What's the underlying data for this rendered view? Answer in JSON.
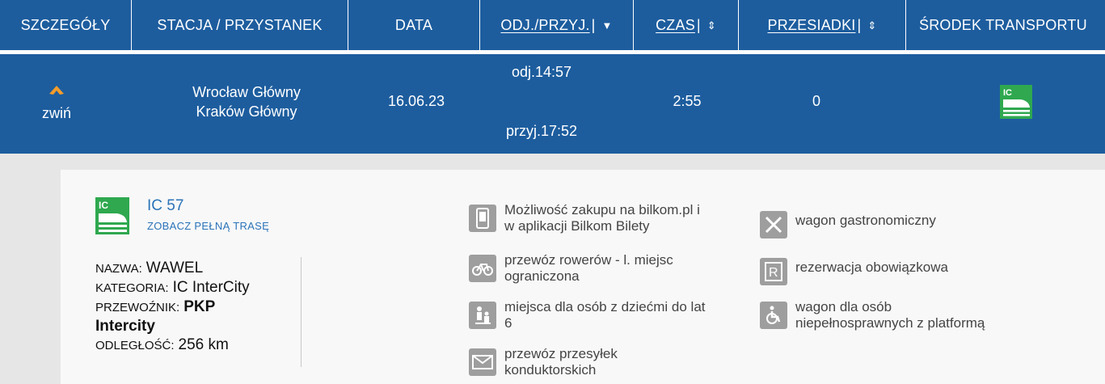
{
  "header": {
    "col_details": "SZCZEGÓŁY",
    "col_station": "STACJA / PRZYSTANEK",
    "col_date": "DATA",
    "col_depart": "ODJ./PRZYJ.",
    "col_time": "CZAS",
    "col_transfers": "PRZESIADKI",
    "col_transport": "ŚRODEK TRANSPORTU",
    "header_bg": "#1d5d9e"
  },
  "row": {
    "collapse_label": "zwiń",
    "from_station": "Wrocław Główny",
    "to_station": "Kraków Główny",
    "date": "16.06.23",
    "departure": "odj.14:57",
    "arrival": "przyj.17:52",
    "duration": "2:55",
    "transfers": "0",
    "transport_icon": "intercity-train-icon",
    "accent_orange": "#f39c2b",
    "icon_green": "#2fa84f"
  },
  "details": {
    "train_number": "IC 57",
    "route_link": "ZOBACZ PEŁNĄ TRASĘ",
    "name_label": "NAZWA:",
    "name_value": "WAWEL",
    "category_label": "KATEGORIA:",
    "category_value": "IC InterCity",
    "carrier_label": "PRZEWOŹNIK:",
    "carrier_value_1": "PKP",
    "carrier_value_2": "Intercity",
    "distance_label": "ODLEGŁOŚĆ:",
    "distance_value": "256  km",
    "features": [
      {
        "icon": "mobile-phone-icon",
        "text_1": "Możliwość zakupu na bilkom.pl i",
        "text_2": "w aplikacji Bilkom Bilety"
      },
      {
        "icon": "bicycle-icon",
        "text_1": "przewóz rowerów - l. miejsc",
        "text_2": "ograniczona"
      },
      {
        "icon": "family-child-icon",
        "text_1": "miejsca dla osób z dziećmi do lat",
        "text_2": "6"
      },
      {
        "icon": "envelope-icon",
        "text_1": "przewóz przesyłek",
        "text_2": "konduktorskich"
      },
      {
        "icon": "fork-knife-icon",
        "text_1": "wagon gastronomiczny",
        "text_2": ""
      },
      {
        "icon": "reservation-r-icon",
        "text_1": "rezerwacja obowiązkowa",
        "text_2": ""
      },
      {
        "icon": "wheelchair-icon",
        "text_1": "wagon dla osób",
        "text_2": "niepełnosprawnych z platformą"
      }
    ]
  }
}
